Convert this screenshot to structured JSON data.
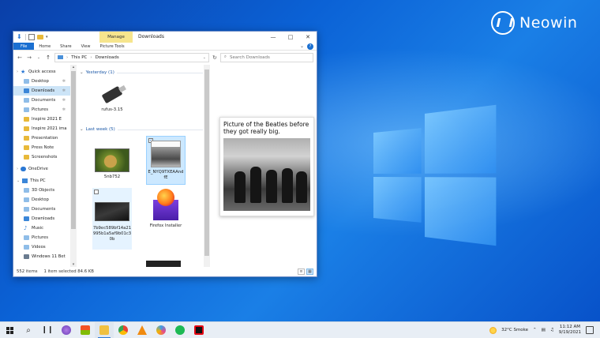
{
  "brand": {
    "name": "Neowin"
  },
  "window": {
    "title": "Downloads",
    "manage_tab": "Manage",
    "ribbon_tabs": [
      "File",
      "Home",
      "Share",
      "View",
      "Picture Tools"
    ],
    "address": {
      "parts": [
        "This PC",
        "Downloads"
      ],
      "search_placeholder": "Search Downloads"
    },
    "nav": [
      {
        "label": "Quick access",
        "icon": "star-icon",
        "level": 0
      },
      {
        "label": "Desktop",
        "icon": "desktop-icon",
        "level": 1,
        "pinned": true
      },
      {
        "label": "Downloads",
        "icon": "downloads-icon",
        "level": 1,
        "pinned": true,
        "selected": true
      },
      {
        "label": "Documents",
        "icon": "documents-icon",
        "level": 1,
        "pinned": true
      },
      {
        "label": "Pictures",
        "icon": "pictures-icon",
        "level": 1,
        "pinned": true
      },
      {
        "label": "Inspire 2021 E",
        "icon": "folder-icon",
        "level": 1
      },
      {
        "label": "Inspire 2021 ima",
        "icon": "folder-icon",
        "level": 1
      },
      {
        "label": "Presentation",
        "icon": "folder-icon",
        "level": 1
      },
      {
        "label": "Press Note",
        "icon": "folder-icon",
        "level": 1
      },
      {
        "label": "Screenshots",
        "icon": "folder-icon",
        "level": 1
      },
      {
        "label": "OneDrive",
        "icon": "cloud-icon",
        "level": 0
      },
      {
        "label": "This PC",
        "icon": "pc-icon",
        "level": 0
      },
      {
        "label": "3D Objects",
        "icon": "cube-icon",
        "level": 1
      },
      {
        "label": "Desktop",
        "icon": "desktop-icon",
        "level": 1
      },
      {
        "label": "Documents",
        "icon": "documents-icon",
        "level": 1
      },
      {
        "label": "Downloads",
        "icon": "downloads-icon",
        "level": 1
      },
      {
        "label": "Music",
        "icon": "music-icon",
        "level": 1
      },
      {
        "label": "Pictures",
        "icon": "pictures-icon",
        "level": 1
      },
      {
        "label": "Videos",
        "icon": "videos-icon",
        "level": 1
      },
      {
        "label": "Windows 11 Bet",
        "icon": "drive-icon",
        "level": 1
      }
    ],
    "groups": [
      {
        "label": "Yesterday (1)"
      },
      {
        "label": "Last week (5)"
      }
    ],
    "files": [
      {
        "name": "rufus-3.15"
      },
      {
        "name": "5nb752"
      },
      {
        "name": "E_NYQ9TXEAAnd fE"
      },
      {
        "name": "7b9ec589bf14a21995b1a5af9b01c30b"
      },
      {
        "name": "Firefox Installer"
      }
    ],
    "preview_caption": "Picture of the Beatles before they got really big.",
    "status": {
      "items": "552 items",
      "selected": "1 item selected  84.6 KB"
    }
  },
  "taskbar": {
    "weather": "32°C  Smoke",
    "time": "11:12 AM",
    "date": "9/19/2021"
  }
}
